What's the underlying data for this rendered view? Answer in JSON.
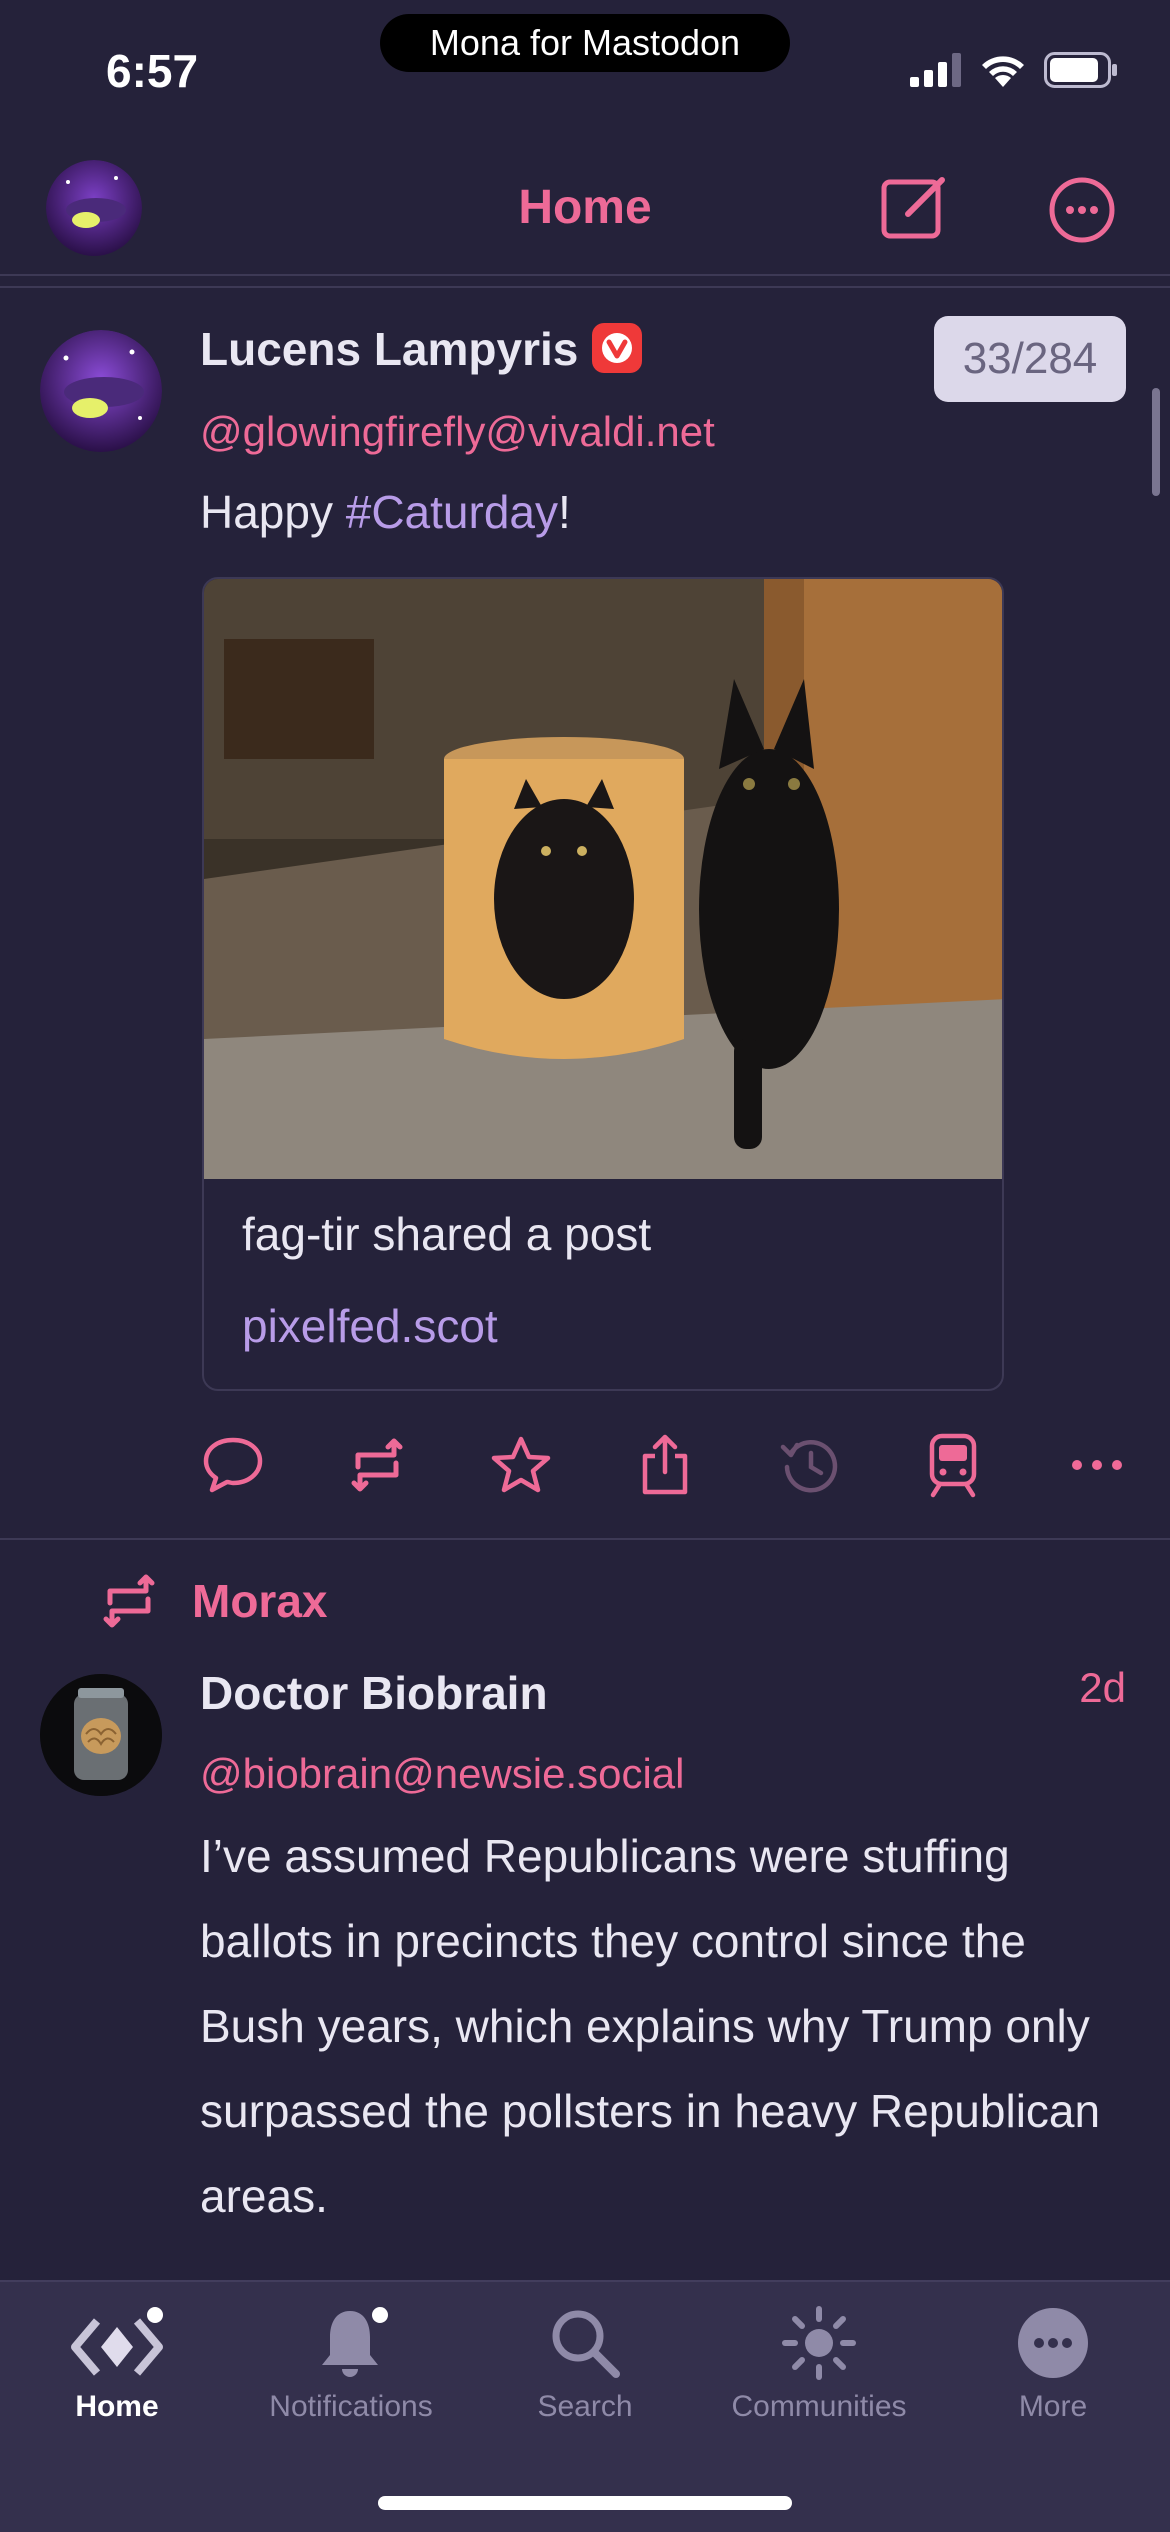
{
  "status_bar": {
    "time": "6:57",
    "app_name": "Mona for Mastodon"
  },
  "nav": {
    "title": "Home",
    "icons": {
      "compose": "compose-icon",
      "more": "more-circle-icon"
    }
  },
  "posts": [
    {
      "display_name": "Lucens Lampyris",
      "handle": "@glowingfirefly@vivaldi.net",
      "counter": "33/284",
      "text_before": "Happy ",
      "hashtag": "#Caturday",
      "text_after": "!",
      "card": {
        "title": "fag-tir shared a post",
        "domain": "pixelfed.scot"
      }
    },
    {
      "boosted_by": "Morax",
      "display_name": "Doctor Biobrain",
      "handle": "@biobrain@newsie.social",
      "time": "2d",
      "text": "I’ve assumed Republicans were stuffing ballots in precincts they control since the Bush years, which explains why Trump only surpassed the pollsters in heavy Republican areas."
    }
  ],
  "actions": [
    "reply-icon",
    "boost-icon",
    "favorite-icon",
    "share-icon",
    "history-icon",
    "train-icon",
    "ellipsis-icon"
  ],
  "tabs": [
    {
      "label": "Home",
      "icon": "home-icon"
    },
    {
      "label": "Notifications",
      "icon": "bell-icon"
    },
    {
      "label": "Search",
      "icon": "search-icon"
    },
    {
      "label": "Communities",
      "icon": "sun-icon"
    },
    {
      "label": "More",
      "icon": "more-icon"
    }
  ],
  "colors": {
    "background": "#25223a",
    "accent": "#ee6a97",
    "hashtag": "#b89ce8",
    "tab_bar": "#34304d"
  }
}
